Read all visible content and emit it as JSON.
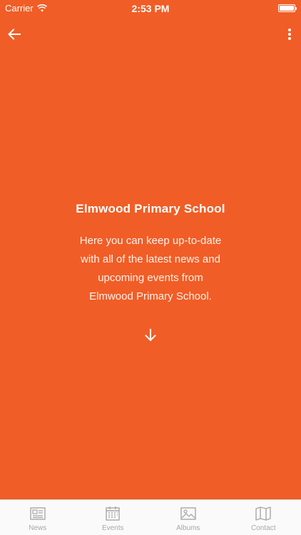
{
  "status_bar": {
    "carrier": "Carrier",
    "time": "2:53 PM",
    "wifi_icon": "wifi-icon",
    "battery_icon": "battery-icon",
    "battery_level": 1.0
  },
  "nav": {
    "back_icon": "arrow-left-icon",
    "more_icon": "more-vertical-icon"
  },
  "content": {
    "title": "Elmwood Primary School",
    "lines": [
      "Here you can keep up-to-date",
      "with all of the latest news and",
      "upcoming events from",
      "Elmwood Primary School."
    ],
    "scroll_icon": "arrow-down-icon"
  },
  "tabs": [
    {
      "label": "News",
      "icon": "newspaper-icon"
    },
    {
      "label": "Events",
      "icon": "calendar-icon"
    },
    {
      "label": "Albums",
      "icon": "image-icon"
    },
    {
      "label": "Contact",
      "icon": "map-icon"
    }
  ],
  "colors": {
    "background": "#F15D26",
    "tab_bar": "#FAFAFA",
    "tab_inactive": "#A8A8A8"
  }
}
